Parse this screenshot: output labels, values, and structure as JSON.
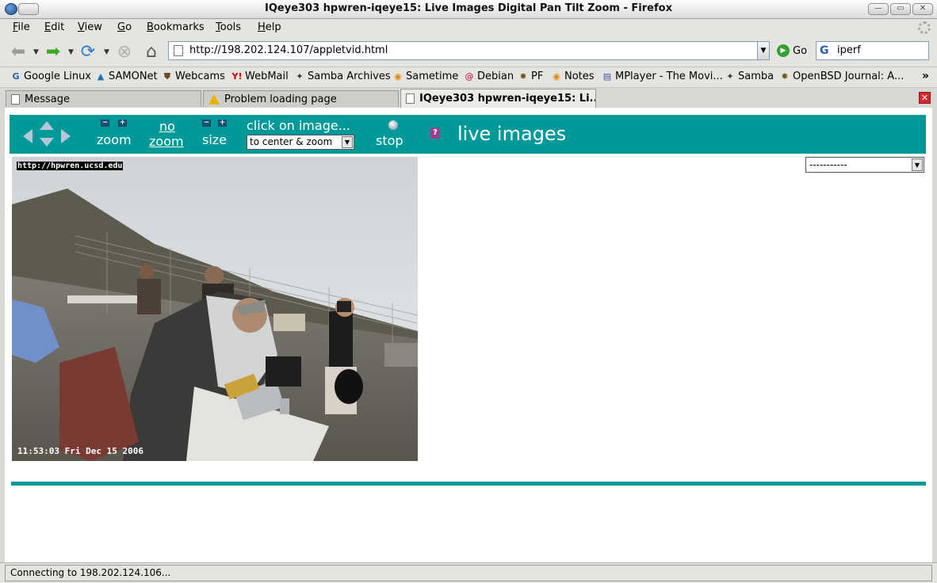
{
  "window": {
    "title": "IQeye303 hpwren-iqeye15: Live Images Digital Pan Tilt Zoom - Firefox",
    "controls": [
      "minimize",
      "maximize",
      "close"
    ]
  },
  "menu": [
    "File",
    "Edit",
    "View",
    "Go",
    "Bookmarks",
    "Tools",
    "Help"
  ],
  "nav": {
    "url": "http://198.202.124.107/appletvid.html",
    "go_label": "Go",
    "search_value": "iperf"
  },
  "bookmarks": [
    "Google Linux",
    "SAMONet",
    "Webcams",
    "WebMail",
    "Samba Archives",
    "Sametime",
    "Debian",
    "PF",
    "Notes",
    "MPlayer - The Movi...",
    "Samba",
    "OpenBSD Journal: A..."
  ],
  "tabs": [
    {
      "label": "Message",
      "active": false
    },
    {
      "label": "Problem loading page",
      "active": false
    },
    {
      "label": "IQeye303 hpwren-iqeye15: Li...",
      "active": true
    }
  ],
  "camera_toolbar": {
    "zoom_label": "zoom",
    "no_label": "no",
    "no_zoom_label": "zoom",
    "size_label": "size",
    "click_label": "click on image...",
    "click_mode_value": "to center & zoom",
    "stop_label": "stop",
    "title": "live images",
    "help_glyph": "?"
  },
  "camera": {
    "overlay_url": "http://hpwren.ucsd.edu",
    "timestamp": "11:53:03 Fri Dec 15 2006"
  },
  "camera_select": {
    "value": "-----------"
  },
  "status": {
    "text": "Connecting to 198.202.124.106..."
  },
  "colors": {
    "teal": "#00999a"
  }
}
